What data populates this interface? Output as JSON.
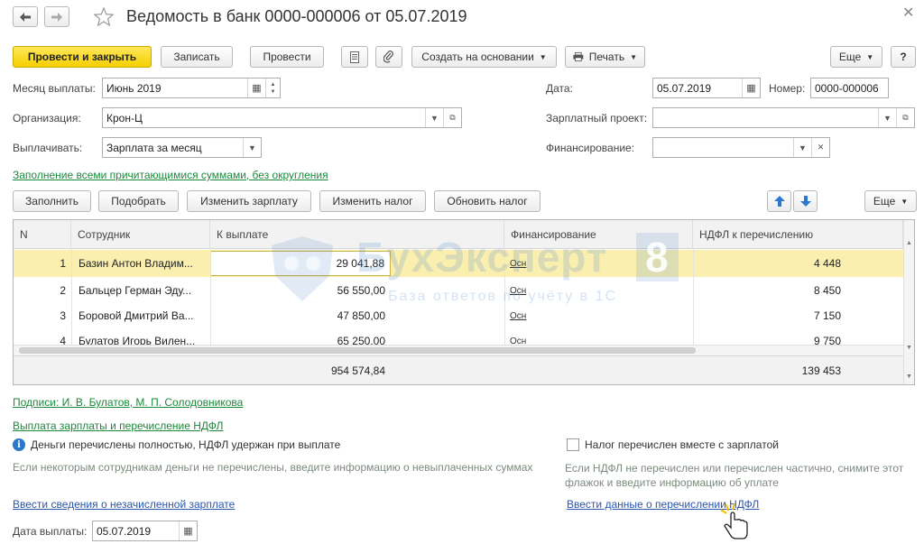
{
  "window": {
    "title": "Ведомость в банк 0000-000006 от 05.07.2019"
  },
  "toolbar": {
    "post_close": "Провести и закрыть",
    "save": "Записать",
    "post": "Провести",
    "create_based": "Создать на основании",
    "print": "Печать",
    "more": "Еще",
    "help": "?"
  },
  "form": {
    "month_label": "Месяц выплаты:",
    "month_value": "Июнь 2019",
    "org_label": "Организация:",
    "org_value": "Крон-Ц",
    "pay_label": "Выплачивать:",
    "pay_value": "Зарплата за месяц",
    "date_label": "Дата:",
    "date_value": "05.07.2019",
    "number_label": "Номер:",
    "number_value": "0000-000006",
    "salary_project_label": "Зарплатный проект:",
    "salary_project_value": "",
    "financing_label": "Финансирование:",
    "financing_value": ""
  },
  "fill_link": "Заполнение всеми причитающимися суммами, без округления",
  "table_toolbar": {
    "fill": "Заполнить",
    "select": "Подобрать",
    "change_salary": "Изменить зарплату",
    "change_tax": "Изменить налог",
    "update_tax": "Обновить налог",
    "more": "Еще"
  },
  "table": {
    "columns": [
      "N",
      "Сотрудник",
      "К выплате",
      "Финансирование",
      "НДФЛ к перечислению"
    ],
    "rows": [
      {
        "n": "1",
        "employee": "Базин Антон Владим...",
        "amount": "29 041,88",
        "financing": "Осн",
        "tax": "4 448"
      },
      {
        "n": "2",
        "employee": "Бальцер Герман Эду...",
        "amount": "56 550,00",
        "financing": "Осн",
        "tax": "8 450"
      },
      {
        "n": "3",
        "employee": "Боровой Дмитрий Ва...",
        "amount": "47 850,00",
        "financing": "Осн",
        "tax": "7 150"
      },
      {
        "n": "4",
        "employee": "Булатов Игорь Вилен...",
        "amount": "65 250,00",
        "financing": "Осн",
        "tax": "9 750"
      }
    ],
    "total_amount": "954 574,84",
    "total_tax": "139 453"
  },
  "watermark": {
    "main": "БухЭксперт",
    "num": "8",
    "sub": "База ответов по учёту в 1С"
  },
  "signatures_link": "Подписи: И. В. Булатов, М. П. Солодовникова",
  "payment_section_link": "Выплата зарплаты и перечисление НДФЛ",
  "status_text": "Деньги перечислены  полностью, НДФЛ удержан при выплате",
  "hint_left": "Если некоторым сотрудникам деньги не перечислены, введите информацию о невыплаченных суммах",
  "link_unpaid": "Ввести сведения о незачисленной зарплате",
  "tax_checkbox_label": "Налог перечислен вместе с зарплатой",
  "hint_right": "Если НДФЛ не перечислен или перечислен частично, снимите этот флажок и введите информацию об уплате",
  "link_tax_data": "Ввести данные о перечислении НДФЛ",
  "payment_date_label": "Дата выплаты:",
  "payment_date_value": "05.07.2019",
  "colors": {
    "primary": "#f5cf00",
    "selected_row": "#fbefb0",
    "link_green": "#1a8a3a",
    "link_blue": "#2a55b0"
  }
}
